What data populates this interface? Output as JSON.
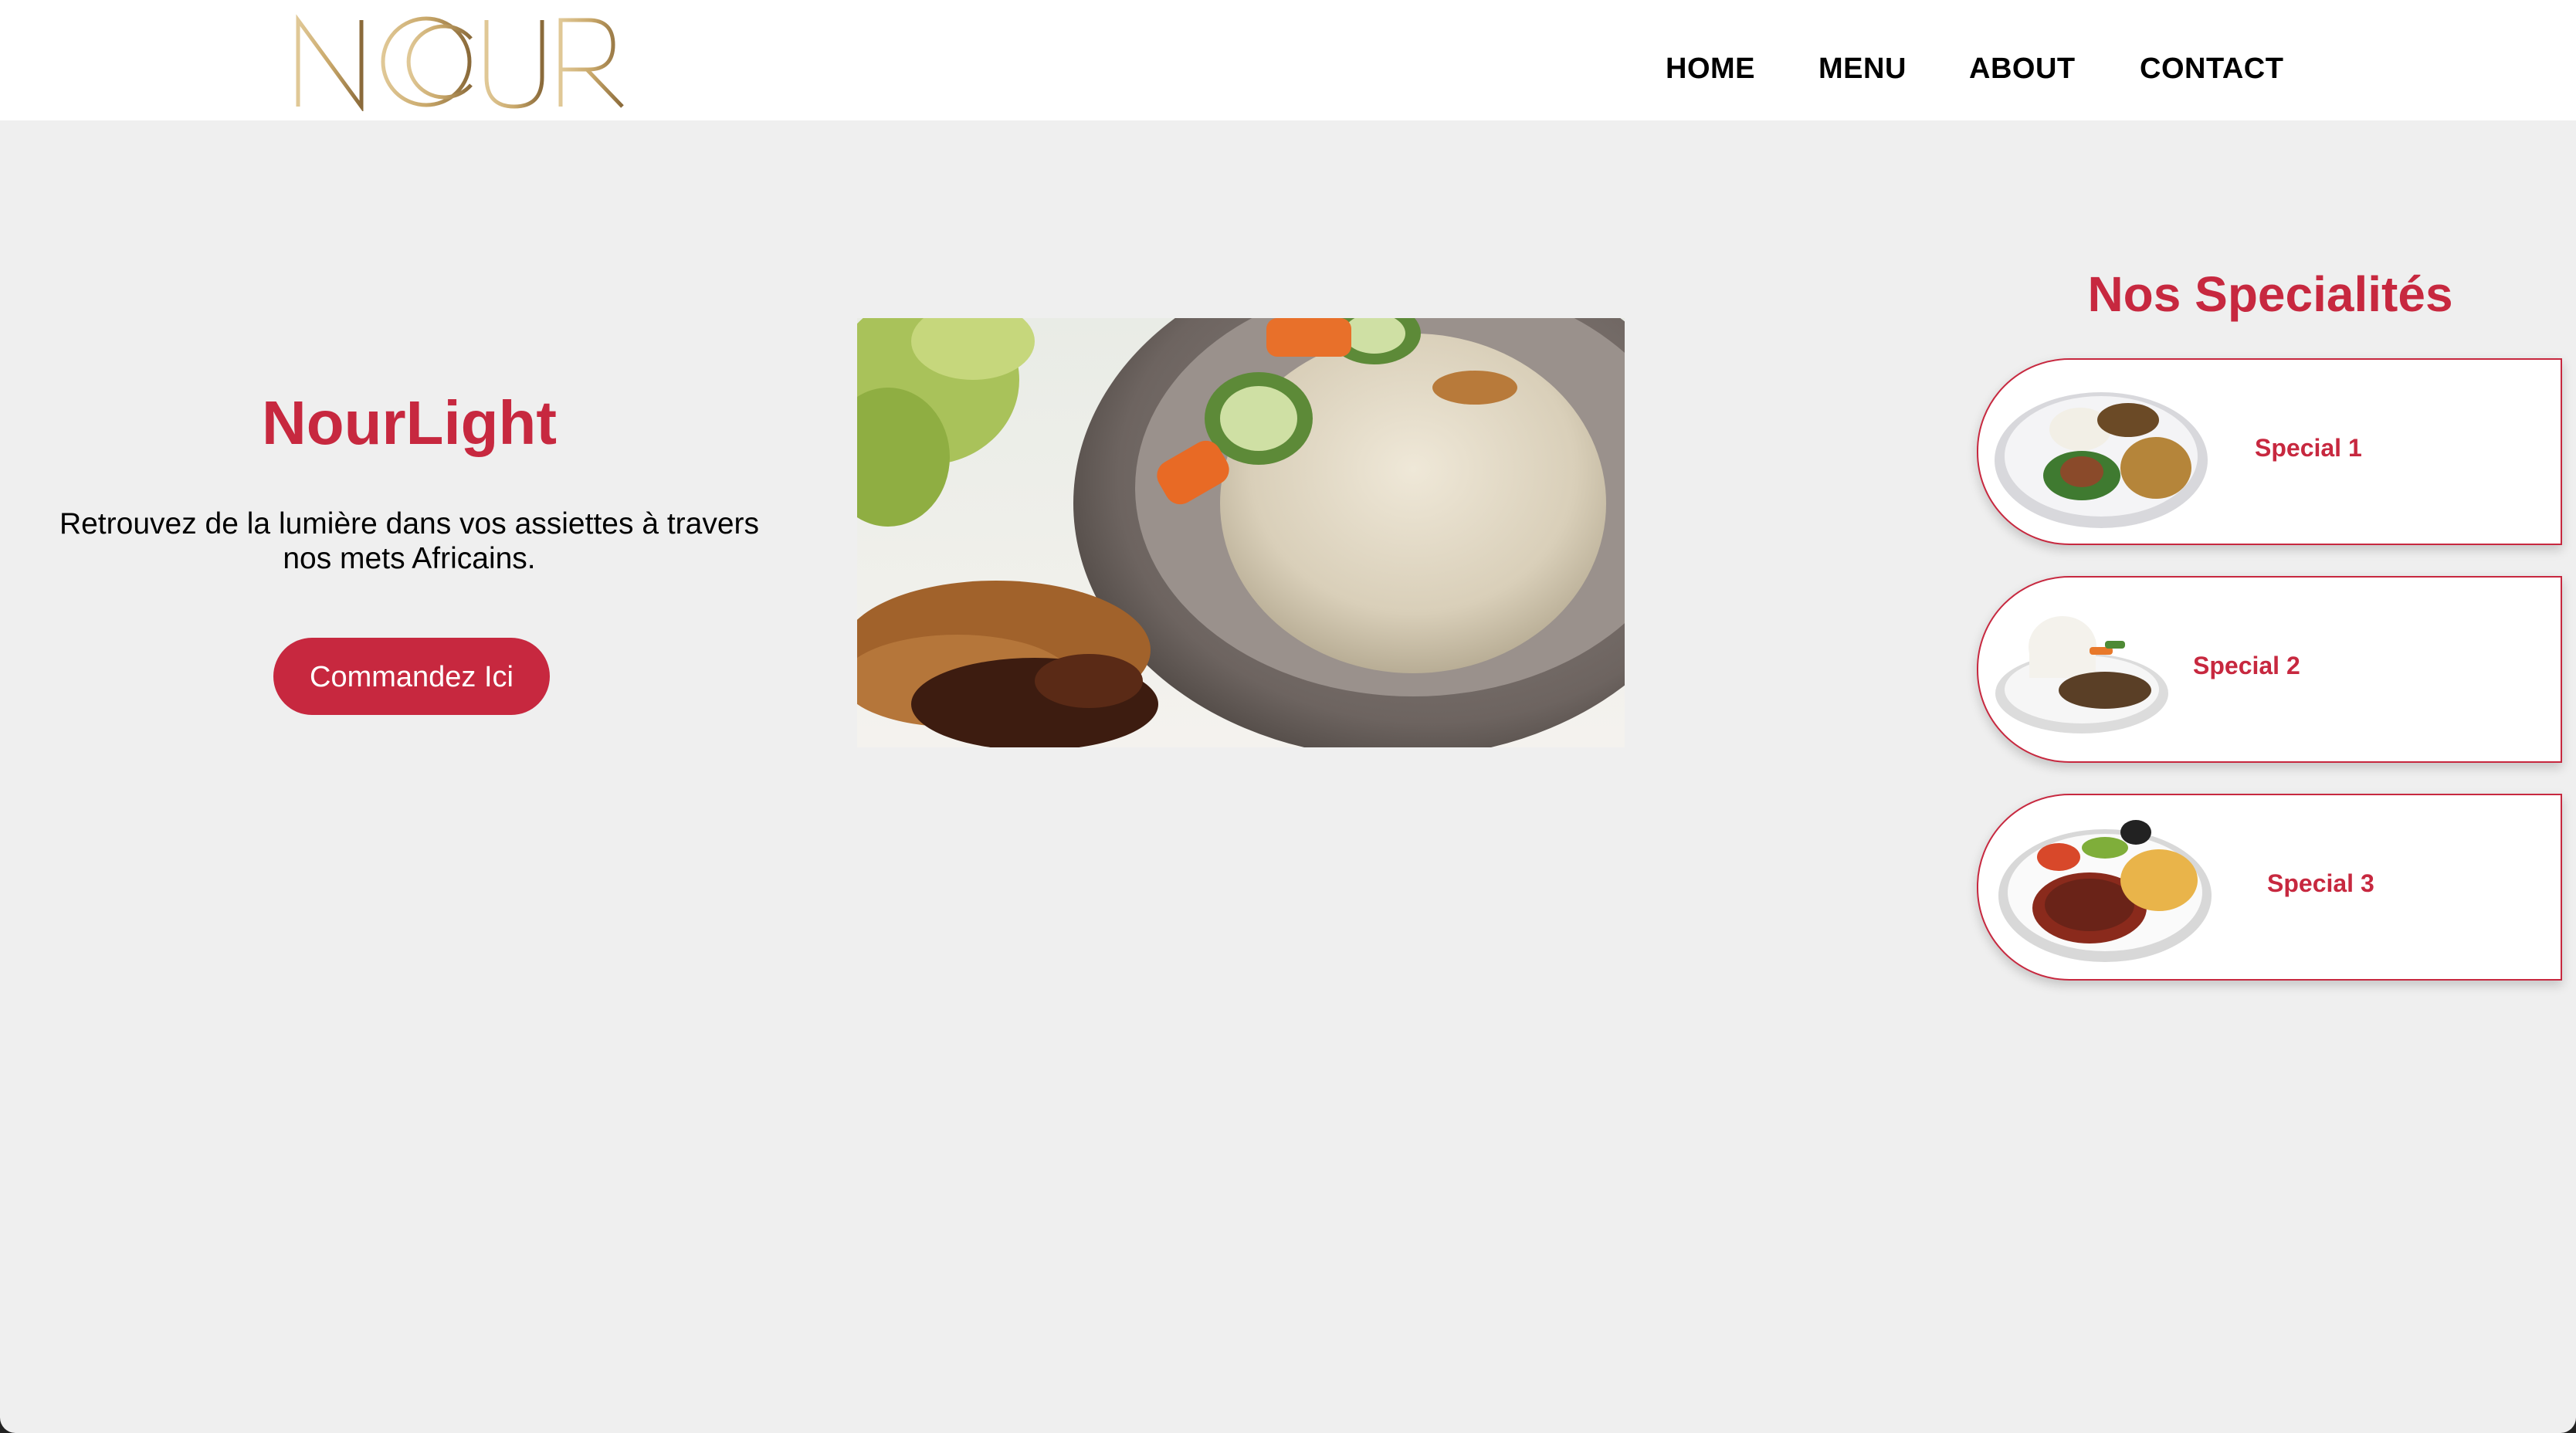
{
  "header": {
    "logo_text": "NOUR",
    "nav": [
      {
        "label": "HOME"
      },
      {
        "label": "MENU"
      },
      {
        "label": "ABOUT"
      },
      {
        "label": "CONTACT"
      }
    ]
  },
  "hero": {
    "title": "NourLight",
    "text": "Retrouvez de la lumière dans vos assiettes à travers nos mets Africains.",
    "cta_label": "Commandez Ici"
  },
  "specials": {
    "title": "Nos Specialités",
    "items": [
      {
        "label": "Special 1"
      },
      {
        "label": "Special 2"
      },
      {
        "label": "Special 3"
      }
    ]
  },
  "colors": {
    "accent": "#c7283f",
    "background": "#efefef",
    "header_bg": "#ffffff",
    "logo_gold": "#c9a86a"
  },
  "icons": {
    "logo": "nour-logo",
    "hero_image": "rice-dish-image",
    "special_1_image": "plate-rice-beans-image",
    "special_2_image": "plate-rice-meat-image",
    "special_3_image": "plate-stew-image"
  }
}
